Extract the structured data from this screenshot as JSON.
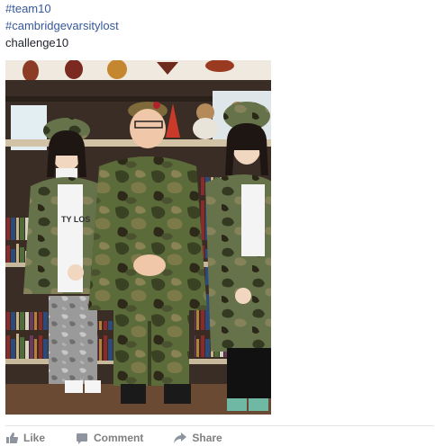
{
  "post": {
    "caption_lines": [
      {
        "text": "#team10",
        "kind": "hashtag"
      },
      {
        "text": "#cambridgevarsitylost",
        "kind": "hashtag"
      },
      {
        "text": "challenge10",
        "kind": "plain"
      }
    ],
    "photo": {
      "shirt_text": "TY LOS"
    }
  },
  "actions": {
    "like_label": "Like",
    "comment_label": "Comment",
    "share_label": "Share"
  },
  "colors": {
    "link": "#365899",
    "text": "#1d2129",
    "action_gray": "#7f7f7f"
  }
}
